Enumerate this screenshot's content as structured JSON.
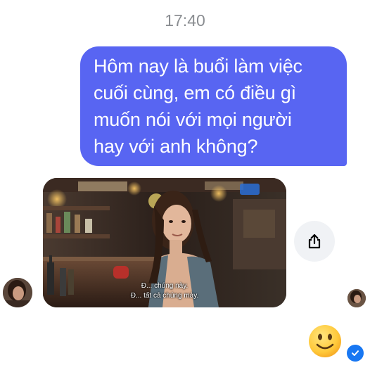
{
  "conversation": {
    "timestamp": "17:40",
    "outgoing_message": {
      "lines": [
        "Hôm nay là buổi làm việc",
        "cuối cùng, em có điều gì",
        "muốn nói với mọi người",
        "hay với anh không?"
      ]
    },
    "media_message": {
      "subtitles": [
        "Đ... chúng này.",
        "Đ... tất cả chúng mày."
      ]
    },
    "share_button": {
      "icon": "share-icon"
    },
    "reaction": {
      "emoji": "🙂"
    },
    "read_receipt": {
      "icon": "check-icon"
    }
  },
  "colors": {
    "outgoing_bubble": "#5865f2",
    "share_button_bg": "#f0f2f5",
    "read_receipt": "#1877f2",
    "timestamp_text": "#8a8d91"
  }
}
